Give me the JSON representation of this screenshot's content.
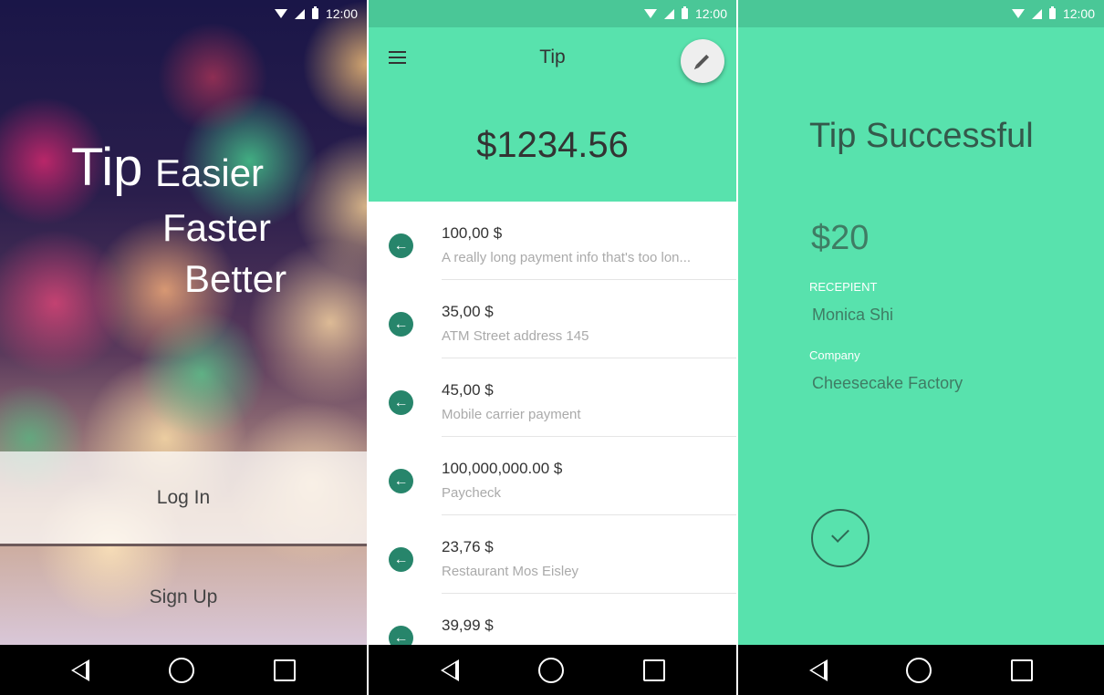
{
  "status_bar": {
    "time": "12:00"
  },
  "welcome": {
    "tagline_tip": "Tip",
    "tagline_easier": "Easier",
    "tagline_faster": "Faster",
    "tagline_better": "Better",
    "login_label": "Log In",
    "signup_label": "Sign Up"
  },
  "wallet": {
    "title": "Tip",
    "balance": "$1234.56",
    "accent_color": "#58e2ad",
    "transactions": [
      {
        "amount": "100,00 $",
        "description": "A really long payment info that's too lon..."
      },
      {
        "amount": "35,00 $",
        "description": "ATM Street address 145"
      },
      {
        "amount": "45,00 $",
        "description": "Mobile carrier payment"
      },
      {
        "amount": "100,000,000.00 $",
        "description": "Paycheck"
      },
      {
        "amount": "23,76 $",
        "description": "Restaurant Mos Eisley"
      },
      {
        "amount": "39,99 $",
        "description": ""
      }
    ]
  },
  "confirmation": {
    "title": "Tip Successful",
    "amount": "$20",
    "recipient_label": "RECEPIENT",
    "recipient_value": "Monica Shi",
    "company_label": "Company",
    "company_value": "Cheesecake Factory"
  },
  "icons": [
    "wifi-icon",
    "cell-signal-icon",
    "battery-icon",
    "menu-icon",
    "pencil-icon",
    "arrow-left-icon",
    "checkmark-icon",
    "back-icon",
    "home-icon",
    "recents-icon"
  ]
}
